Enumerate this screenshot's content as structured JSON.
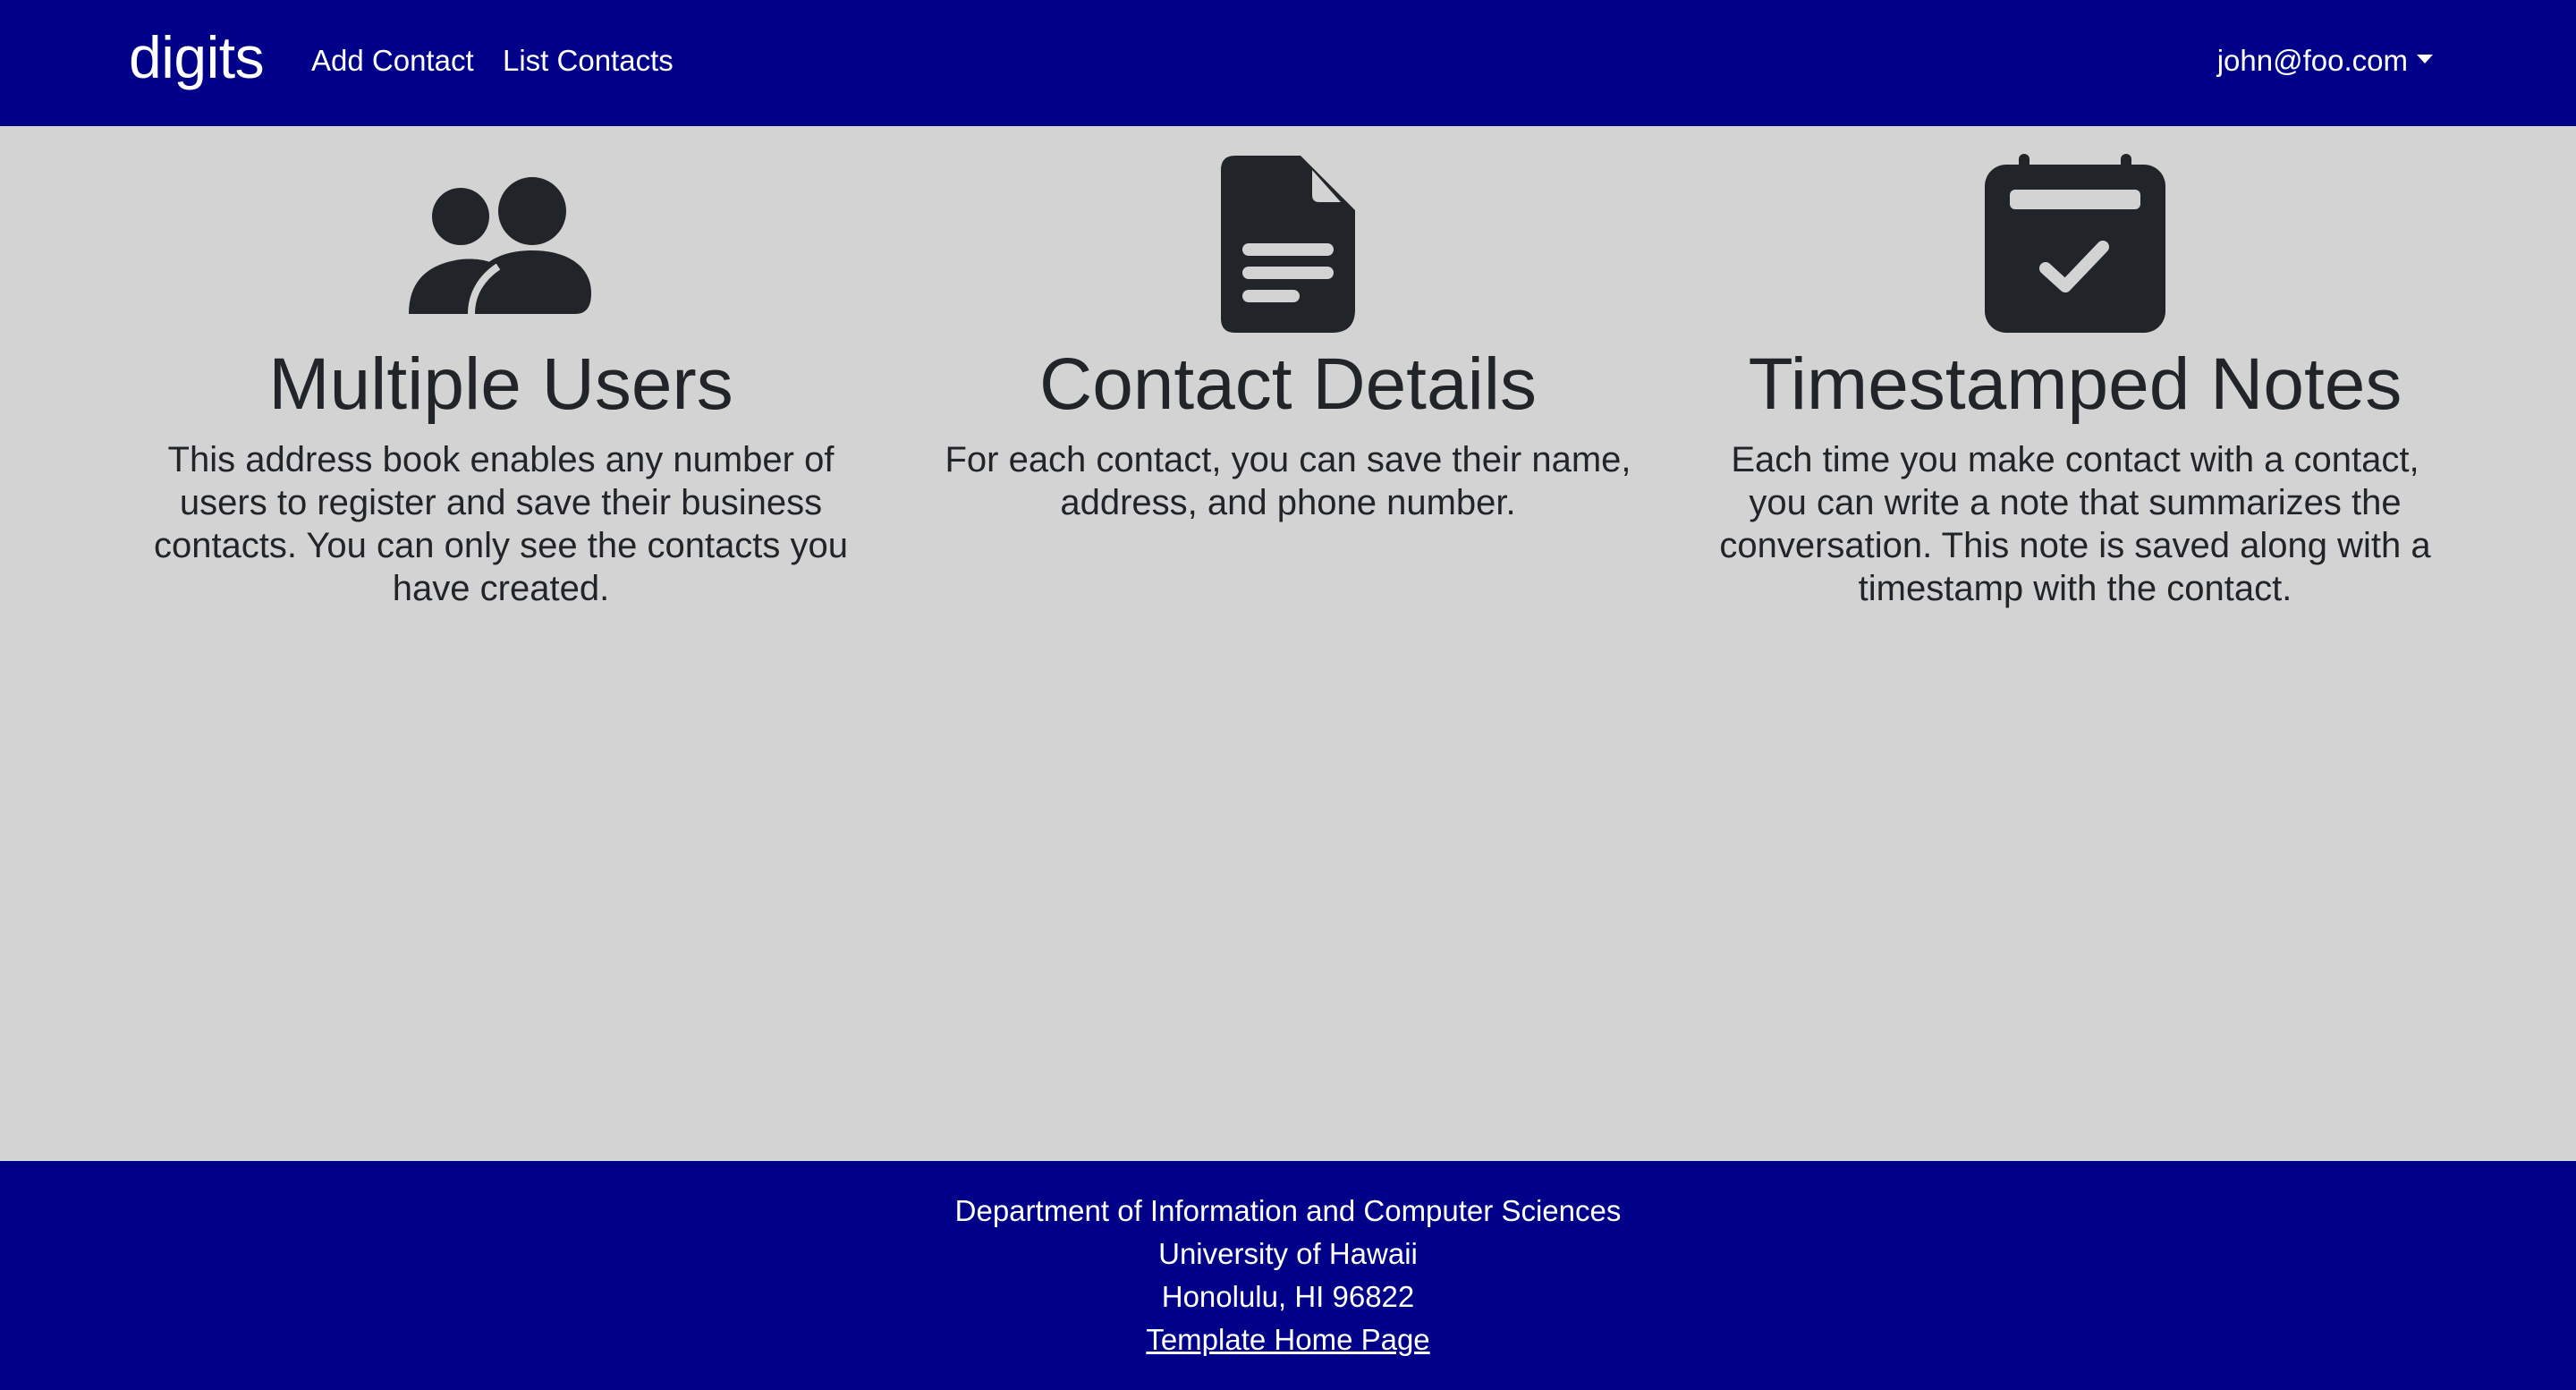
{
  "navbar": {
    "brand": "digits",
    "links": [
      {
        "label": "Add Contact"
      },
      {
        "label": "List Contacts"
      }
    ],
    "user_menu": {
      "label": "john@foo.com"
    }
  },
  "features": [
    {
      "icon": "users-icon",
      "title": "Multiple Users",
      "text": "This address book enables any number of users to register and save their business contacts. You can only see the contacts you have created."
    },
    {
      "icon": "file-text-icon",
      "title": "Contact Details",
      "text": "For each contact, you can save their name, address, and phone number."
    },
    {
      "icon": "calendar-check-icon",
      "title": "Timestamped Notes",
      "text": "Each time you make contact with a contact, you can write a note that summarizes the conversation. This note is saved along with a timestamp with the contact."
    }
  ],
  "footer": {
    "lines": [
      "Department of Information and Computer Sciences",
      "University of Hawaii",
      "Honolulu, HI 96822"
    ],
    "link_label": "Template Home Page"
  },
  "colors": {
    "navbar_bg": "#000088",
    "page_bg": "#d3d3d3",
    "text_dark": "#212529",
    "text_light": "#ffffff"
  }
}
